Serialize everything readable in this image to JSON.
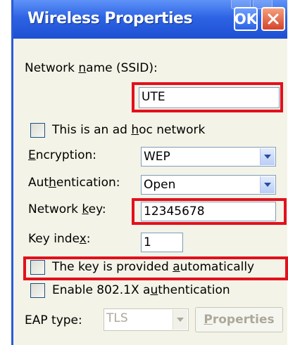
{
  "dialog": {
    "title": "Wireless Properties",
    "ok_label": "OK"
  },
  "fields": {
    "ssid": {
      "label_pre": "Network ",
      "label_u": "n",
      "label_post": "ame (SSID):",
      "value": "UTE"
    },
    "adhoc": {
      "label_pre": "This is an ad ",
      "label_u": "h",
      "label_post": "oc network",
      "checked": false
    },
    "encryption": {
      "label_pre": "",
      "label_u": "E",
      "label_post": "ncryption:",
      "value": "WEP"
    },
    "authentication": {
      "label_pre": "Aut",
      "label_u": "h",
      "label_post": "entication:",
      "value": "Open"
    },
    "network_key": {
      "label_pre": "Network ",
      "label_u": "k",
      "label_post": "ey:",
      "value": "12345678"
    },
    "key_index": {
      "label_pre": "Key inde",
      "label_u": "x",
      "label_post": ":",
      "value": "1"
    },
    "key_auto": {
      "label_pre": "The key is provided ",
      "label_u": "a",
      "label_post": "utomatically",
      "checked": false
    },
    "enable_8021x": {
      "label_pre": "Enable 802.1X a",
      "label_u": "u",
      "label_post": "thentication",
      "checked": false
    },
    "eap_type": {
      "label": "EAP type:",
      "value": "TLS",
      "enabled": false
    },
    "properties_button": {
      "label_pre": "",
      "label_u": "P",
      "label_post": "roperties",
      "enabled": false
    }
  },
  "colors": {
    "titlebar": "#2d64e4",
    "highlight": "#e3101c",
    "dialog_bg": "#f3f3e7"
  }
}
